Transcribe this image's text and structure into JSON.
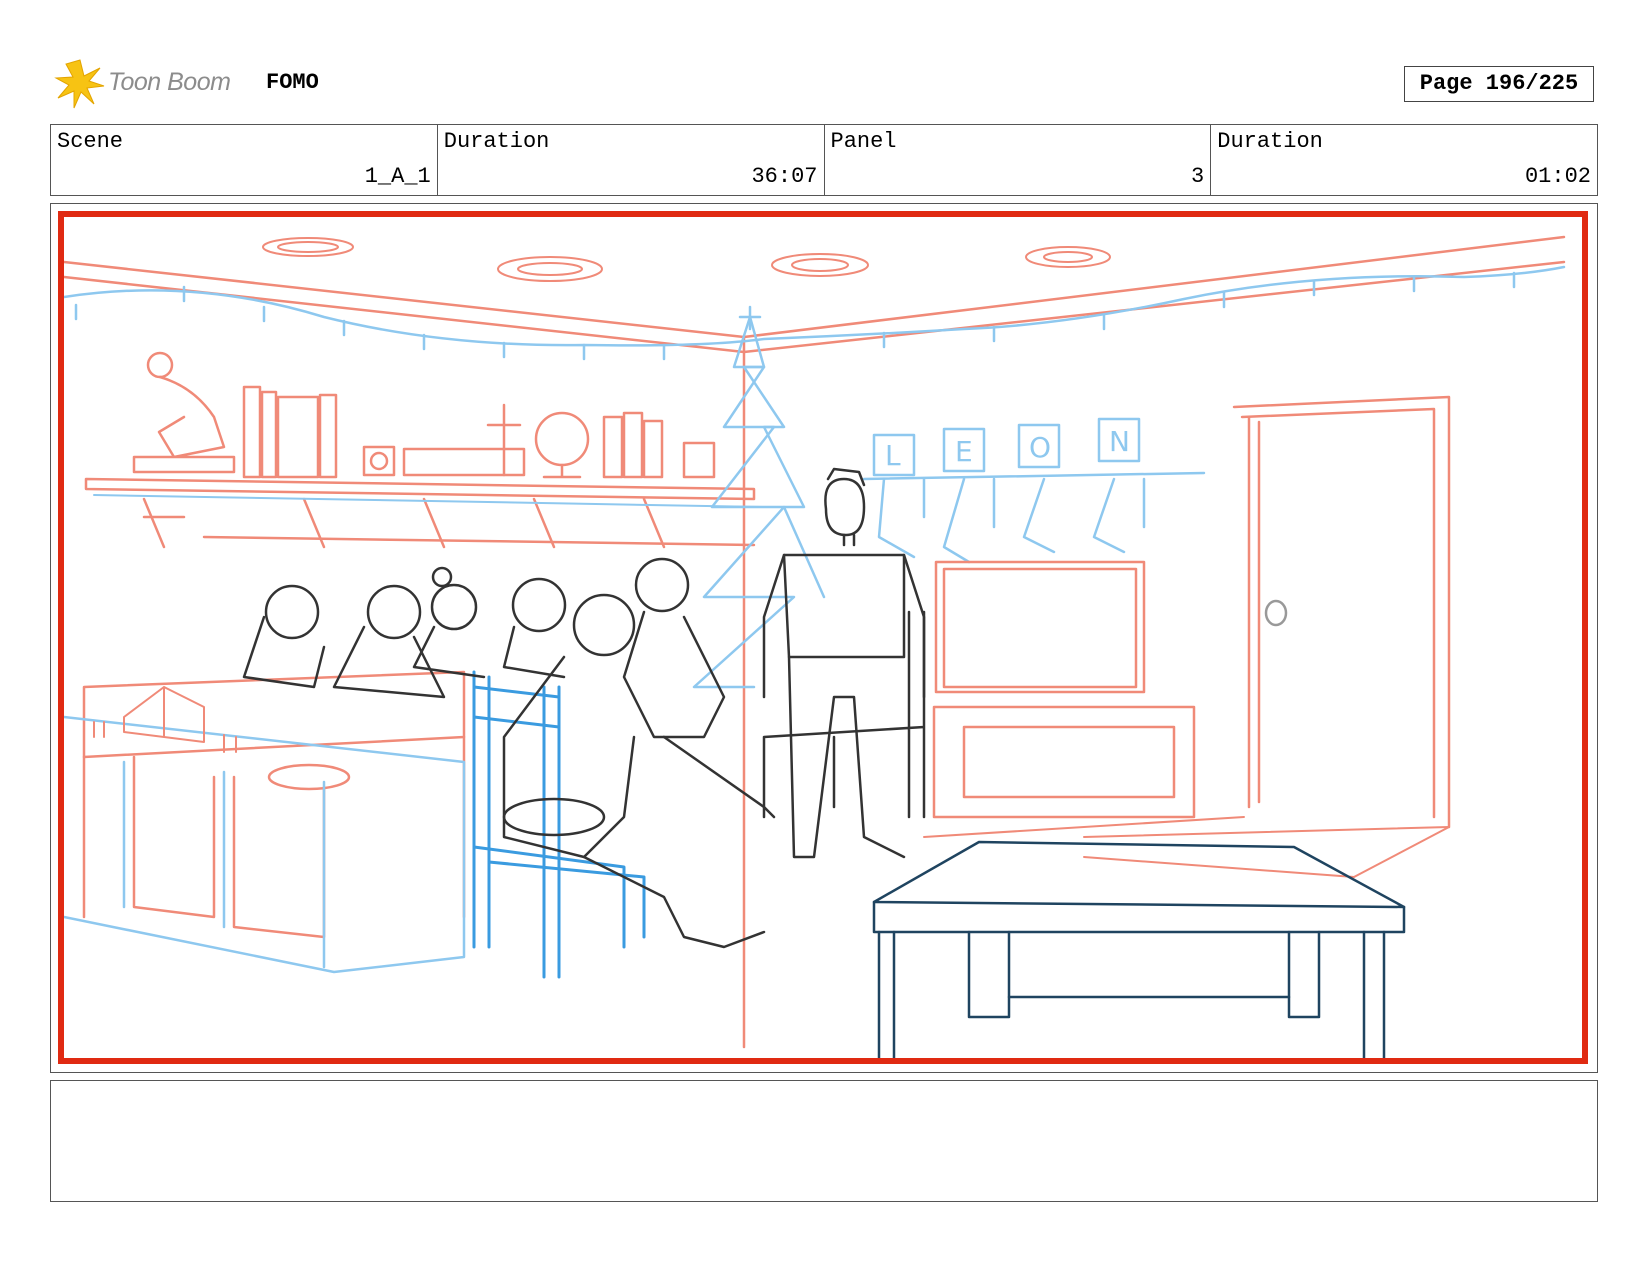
{
  "header": {
    "logo_text": "Toon Boom",
    "project": "FOMO",
    "page": "Page 196/225"
  },
  "info": {
    "scene_label": "Scene",
    "scene_value": "1_A_1",
    "scene_duration_label": "Duration",
    "scene_duration_value": "36:07",
    "panel_label": "Panel",
    "panel_value": "3",
    "panel_duration_label": "Duration",
    "panel_duration_value": "01:02"
  },
  "sketch": {
    "name_blocks": [
      "L",
      "E",
      "O",
      "N"
    ],
    "colors": {
      "frame": "#e02a12",
      "set_red": "#f08a78",
      "set_blue": "#8ec8ef",
      "chair_blue": "#3a9be0",
      "characters": "#333333",
      "table": "#1f4460"
    }
  },
  "notes": {
    "text": ""
  }
}
